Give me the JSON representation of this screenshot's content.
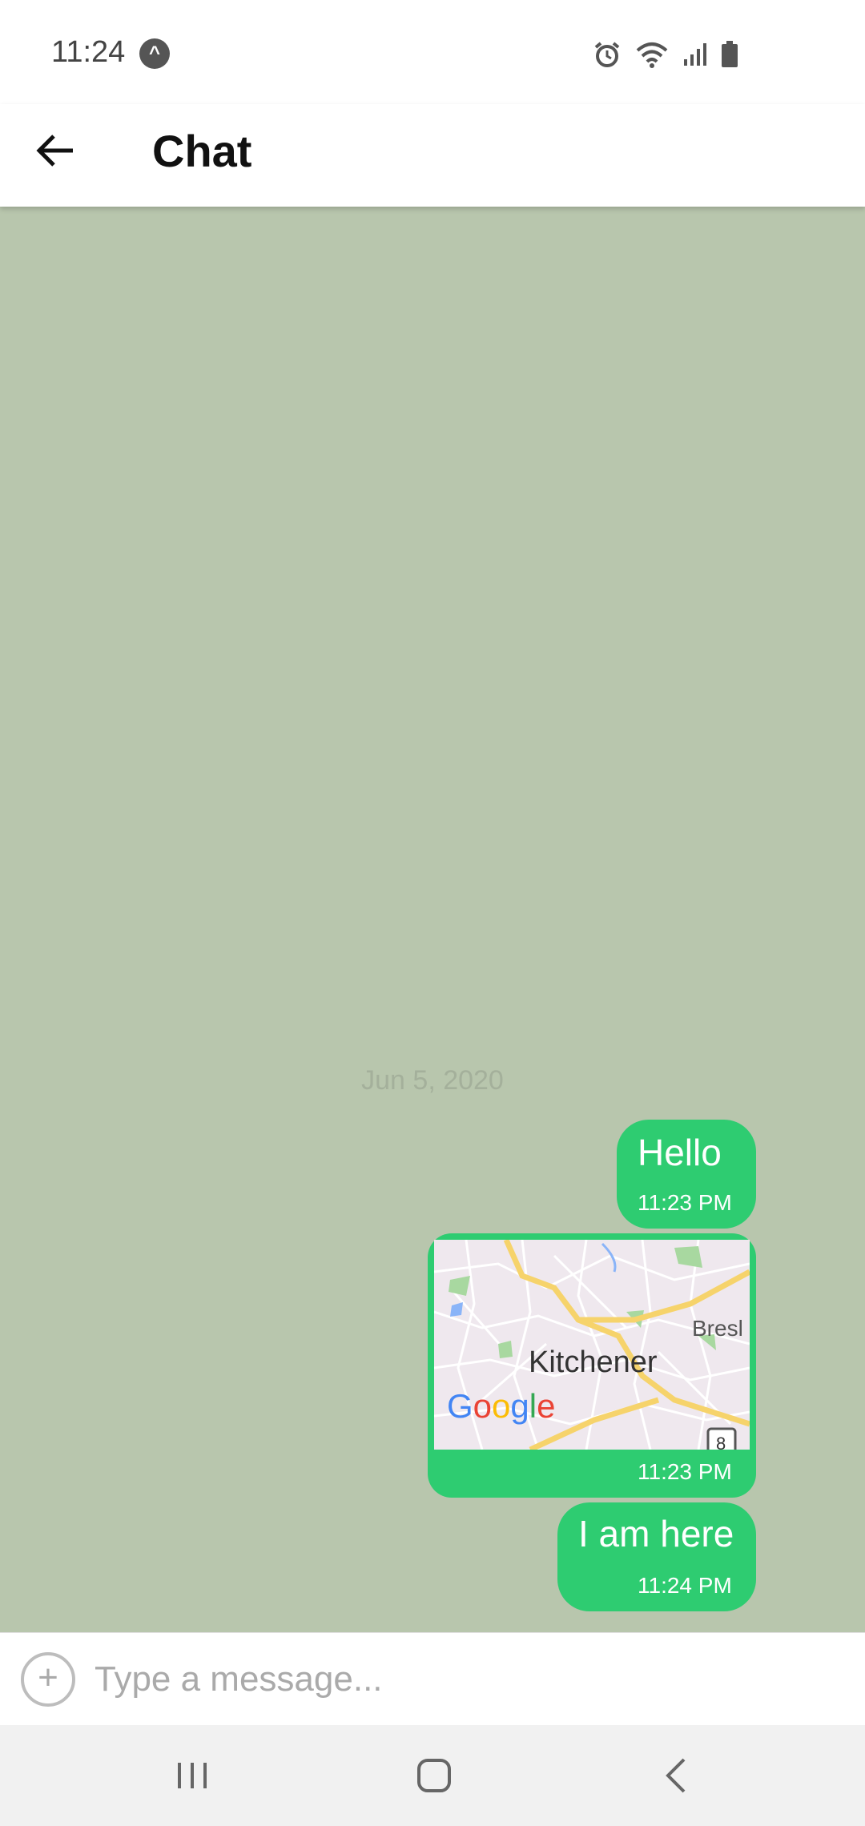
{
  "status_bar": {
    "time": "11:24",
    "icons": [
      "expo-icon",
      "alarm-icon",
      "wifi-icon",
      "signal-icon",
      "battery-icon"
    ]
  },
  "app_bar": {
    "back_icon": "arrow-left-icon",
    "title": "Chat"
  },
  "chat": {
    "background_color": "#b8c6ad",
    "bubble_color": "#2ecc71",
    "date_separator": "Jun 5, 2020",
    "messages": [
      {
        "type": "text",
        "text": "Hello",
        "time": "11:23 PM"
      },
      {
        "type": "location",
        "map_city": "Kitchener",
        "map_nearby": "Bresl",
        "map_route": "8",
        "map_brand": "Google",
        "time": "11:23 PM"
      },
      {
        "type": "text",
        "text": "I am here",
        "time": "11:24 PM"
      }
    ]
  },
  "composer": {
    "attach_icon": "plus-circle-icon",
    "placeholder": "Type a message..."
  },
  "nav_bar": {
    "items": [
      "recents-icon",
      "home-icon",
      "back-icon"
    ]
  }
}
